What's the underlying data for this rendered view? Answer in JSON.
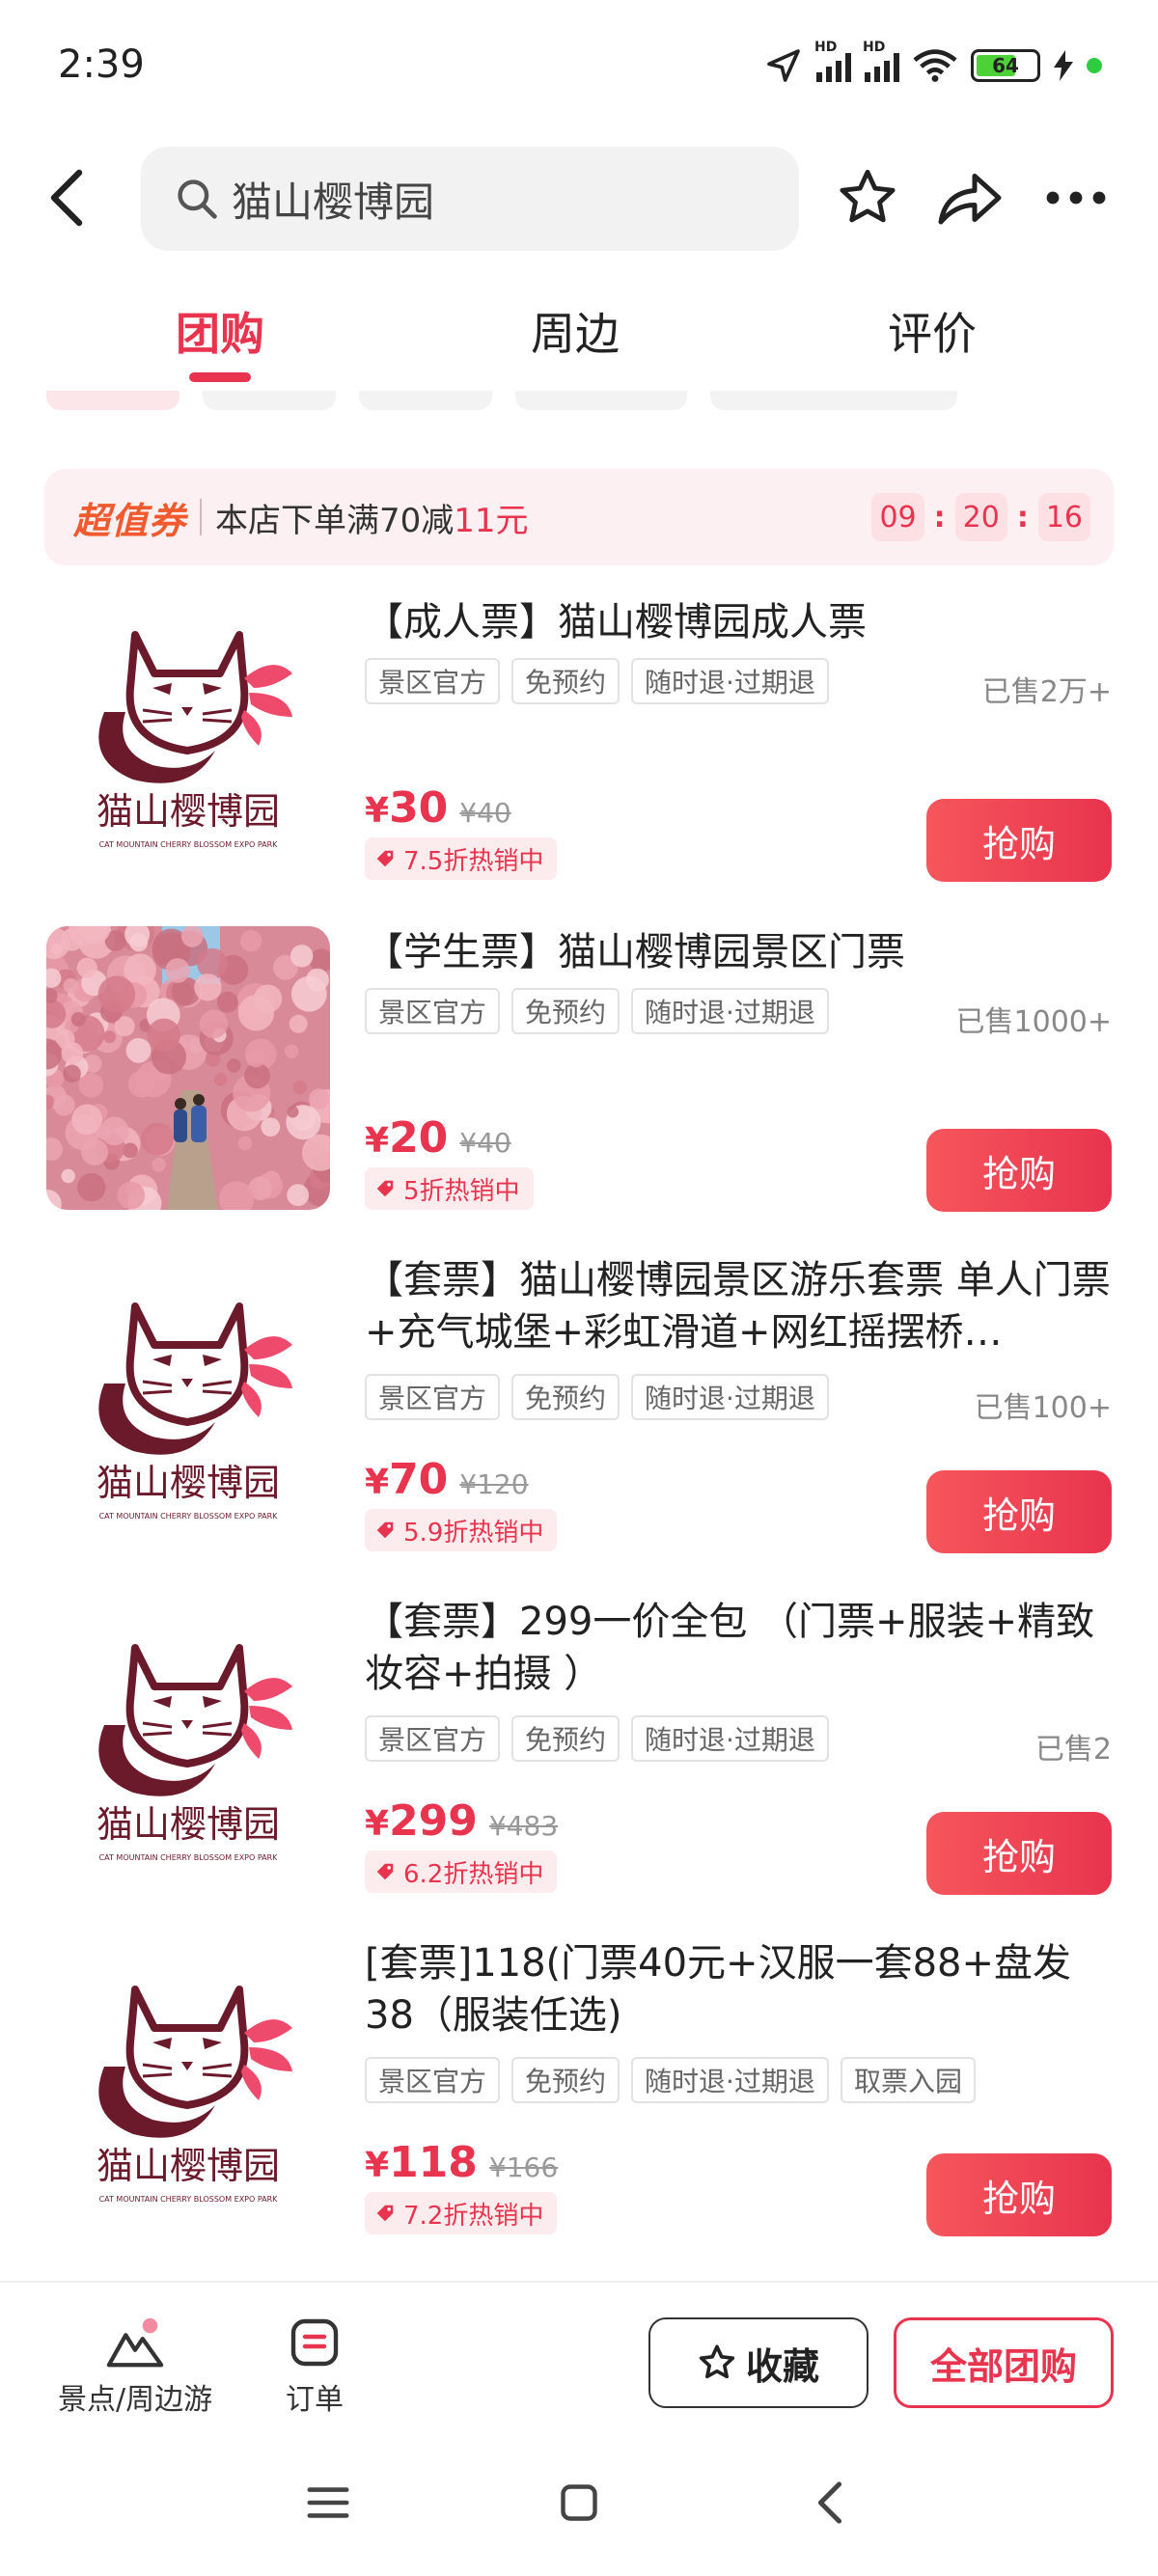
{
  "status_bar": {
    "time": "2:39",
    "battery": "64",
    "hd1": "HD",
    "hd2": "HD"
  },
  "header": {
    "search_text": "猫山樱博园"
  },
  "tabs": [
    {
      "label": "团购",
      "active": true
    },
    {
      "label": "周边",
      "active": false
    },
    {
      "label": "评价",
      "active": false
    }
  ],
  "coupon": {
    "logo": "超值券",
    "text_prefix": "本店下单满70减",
    "text_highlight": "11元",
    "countdown": [
      "09",
      "20",
      "16"
    ]
  },
  "products": [
    {
      "title": "【成人票】猫山樱博园成人票",
      "tags": [
        "景区官方",
        "免预约",
        "随时退·过期退"
      ],
      "sold": "已售2万+",
      "currency": "¥",
      "price": "30",
      "original_price": "¥40",
      "discount": "7.5折热销中",
      "buy_label": "抢购",
      "thumb": "logo"
    },
    {
      "title": "【学生票】猫山樱博园景区门票",
      "tags": [
        "景区官方",
        "免预约",
        "随时退·过期退"
      ],
      "sold": "已售1000+",
      "currency": "¥",
      "price": "20",
      "original_price": "¥40",
      "discount": "5折热销中",
      "buy_label": "抢购",
      "thumb": "photo"
    },
    {
      "title": "【套票】猫山樱博园景区游乐套票 单人门票+充气城堡+彩虹滑道+网红摇摆桥…",
      "tags": [
        "景区官方",
        "免预约",
        "随时退·过期退"
      ],
      "sold": "已售100+",
      "currency": "¥",
      "price": "70",
      "original_price": "¥120",
      "discount": "5.9折热销中",
      "buy_label": "抢购",
      "thumb": "logo"
    },
    {
      "title": "【套票】299一价全包 （门票+服装+精致妆容+拍摄 ）",
      "tags": [
        "景区官方",
        "免预约",
        "随时退·过期退"
      ],
      "sold": "已售2",
      "currency": "¥",
      "price": "299",
      "original_price": "¥483",
      "discount": "6.2折热销中",
      "buy_label": "抢购",
      "thumb": "logo"
    },
    {
      "title": "[套票]118(门票40元+汉服一套88+盘发38（服装任选)",
      "tags": [
        "景区官方",
        "免预约",
        "随时退·过期退",
        "取票入园"
      ],
      "sold": "",
      "currency": "¥",
      "price": "118",
      "original_price": "¥166",
      "discount": "7.2折热销中",
      "buy_label": "抢购",
      "thumb": "logo"
    }
  ],
  "logo": {
    "name": "猫山樱博园",
    "subtitle": "CAT MOUNTAIN CHERRY BLOSSOM EXPO PARK"
  },
  "bottom_bar": {
    "nav1": "景点/周边游",
    "nav2": "订单",
    "favorite": "收藏",
    "all_group": "全部团购"
  },
  "colors": {
    "accent": "#e8344e",
    "coupon_bg": "#fdf0f2",
    "logo_dark": "#6b1a2c",
    "logo_pink": "#ee4a6c"
  }
}
